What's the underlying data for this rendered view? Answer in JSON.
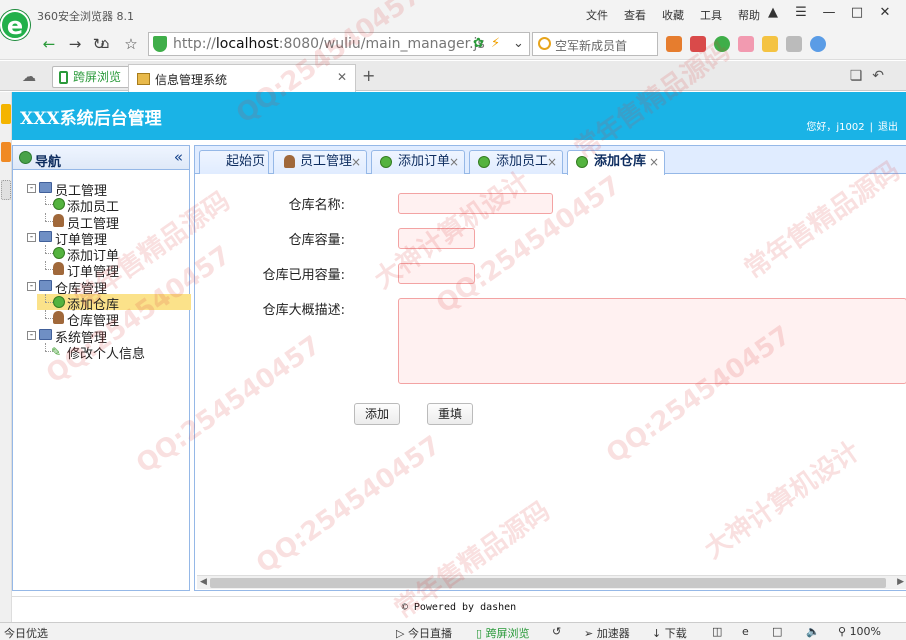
{
  "browser": {
    "window_title": "360安全浏览器 8.1",
    "menu": [
      "文件",
      "查看",
      "收藏",
      "工具",
      "帮助"
    ],
    "url_prefix": "http://",
    "url_host": "localhost",
    "url_rest": ":8080/wuliu/main_manager.js",
    "search_text": "空军新成员首",
    "split_view_label": "跨屏浏览",
    "tab_title": "信息管理系统"
  },
  "app": {
    "title": "XXX系统后台管理",
    "greeting": "您好，j1002",
    "logout": "退出",
    "footer": "© Powered by dashen",
    "header_color": "#1ab3e6"
  },
  "nav": {
    "title": "导航",
    "tree": [
      {
        "label": "员工管理",
        "children": [
          "添加员工",
          "员工管理"
        ]
      },
      {
        "label": "订单管理",
        "children": [
          "添加订单",
          "订单管理"
        ]
      },
      {
        "label": "仓库管理",
        "children": [
          "添加仓库",
          "仓库管理"
        ]
      },
      {
        "label": "系统管理",
        "children": [
          "修改个人信息"
        ]
      }
    ],
    "selected": "添加仓库"
  },
  "tabs": [
    {
      "label": "起始页",
      "closable": false,
      "icon": "none"
    },
    {
      "label": "员工管理",
      "closable": true,
      "icon": "person-icon"
    },
    {
      "label": "添加订单",
      "closable": true,
      "icon": "add-icon"
    },
    {
      "label": "添加员工",
      "closable": true,
      "icon": "add-icon"
    },
    {
      "label": "添加仓库",
      "closable": true,
      "icon": "add-icon",
      "active": true
    }
  ],
  "form": {
    "fields": [
      {
        "label": "仓库名称:",
        "value": ""
      },
      {
        "label": "仓库容量:",
        "value": ""
      },
      {
        "label": "仓库已用容量:",
        "value": ""
      },
      {
        "label": "仓库大概描述:",
        "value": ""
      }
    ],
    "submit_label": "添加",
    "reset_label": "重填"
  },
  "statusbar": {
    "left": "今日优选",
    "items": [
      "今日直播",
      "跨屏浏览",
      "加速器",
      "下载"
    ],
    "zoom": "100%"
  },
  "watermarks": [
    "大神计算机设计",
    "QQ:254540457",
    "常年售精品源码"
  ]
}
